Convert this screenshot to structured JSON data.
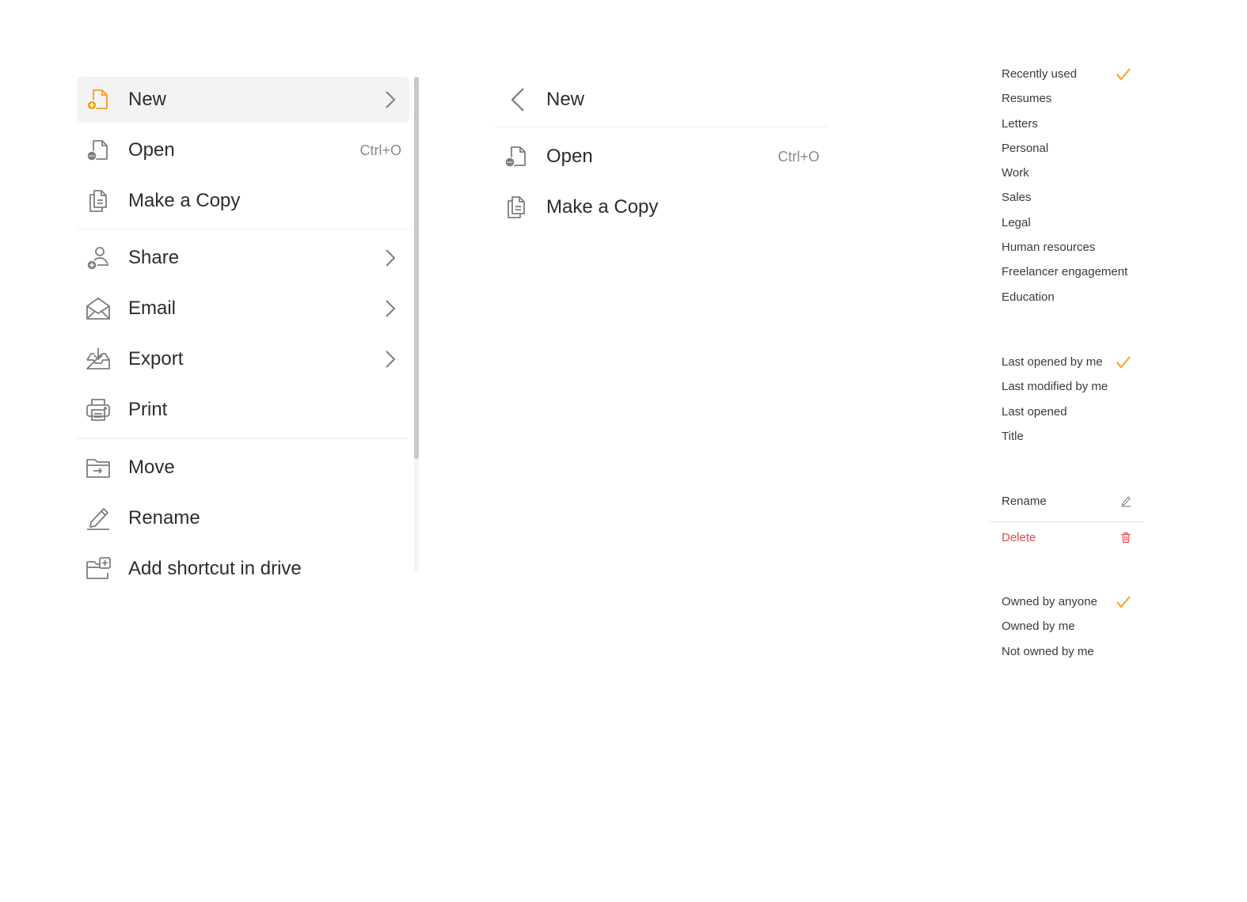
{
  "file_menu": {
    "items": [
      {
        "label": "New",
        "icon": "new-file-icon"
      },
      {
        "label": "Open",
        "shortcut": "Ctrl+O",
        "icon": "open-file-icon"
      },
      {
        "label": "Make a Copy",
        "icon": "copy-icon"
      },
      {
        "label": "Share",
        "icon": "share-user-icon"
      },
      {
        "label": "Email",
        "icon": "envelope-icon"
      },
      {
        "label": "Export",
        "icon": "export-tray-icon"
      },
      {
        "label": "Print",
        "icon": "printer-icon"
      },
      {
        "label": "Move",
        "icon": "move-folder-icon"
      },
      {
        "label": "Rename",
        "icon": "pencil-icon"
      },
      {
        "label": "Add shortcut in drive",
        "icon": "add-folder-icon"
      }
    ]
  },
  "submenu": {
    "title": "New",
    "items": [
      {
        "label": "Open",
        "shortcut": "Ctrl+O",
        "icon": "open-file-icon"
      },
      {
        "label": "Make a Copy",
        "icon": "copy-icon"
      }
    ]
  },
  "template_filter": {
    "items": [
      "Recently used",
      "Resumes",
      "Letters",
      "Personal",
      "Work",
      "Sales",
      "Legal",
      "Human resources",
      "Freelancer engagement",
      "Education"
    ],
    "selected": "Recently used"
  },
  "sort_options": {
    "items": [
      "Last opened by me",
      "Last modified by me",
      "Last opened",
      "Title"
    ],
    "selected": "Last opened by me"
  },
  "doc_actions": {
    "rename_label": "Rename",
    "delete_label": "Delete"
  },
  "owner_filter": {
    "items": [
      "Owned by anyone",
      "Owned by me",
      "Not owned by me"
    ],
    "selected": "Owned by anyone"
  },
  "colors": {
    "accent": "#f5a01e",
    "danger": "#e8474b",
    "icon_gray": "#7d7d7d",
    "highlight_bg": "#f3f3f3"
  }
}
